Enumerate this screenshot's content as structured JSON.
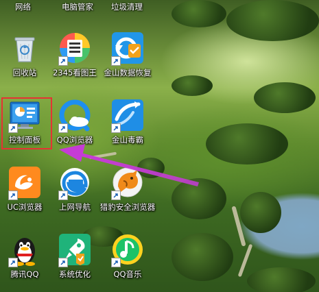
{
  "desktop": {
    "top_row_labels": [
      "网络",
      "电脑管家",
      "垃圾清理"
    ],
    "icons": [
      {
        "label": "回收站",
        "icon": "recycle-bin-icon"
      },
      {
        "label": "2345看图王",
        "icon": "image-viewer-icon"
      },
      {
        "label": "金山数据恢复",
        "icon": "data-recovery-icon"
      },
      {
        "label": "控制面板",
        "icon": "control-panel-icon"
      },
      {
        "label": "QQ浏览器",
        "icon": "qq-browser-icon"
      },
      {
        "label": "金山毒霸",
        "icon": "antivirus-icon"
      },
      {
        "label": "UC浏览器",
        "icon": "uc-browser-icon"
      },
      {
        "label": "上网导航",
        "icon": "ie-navigation-icon"
      },
      {
        "label": "猎豹安全浏览器",
        "icon": "cheetah-browser-icon"
      },
      {
        "label": "腾讯QQ",
        "icon": "qq-penguin-icon"
      },
      {
        "label": "系统优化",
        "icon": "system-optimize-icon"
      },
      {
        "label": "QQ音乐",
        "icon": "qq-music-icon"
      }
    ],
    "highlight_color": "#e53333",
    "arrow_color": "#d23ad8"
  }
}
